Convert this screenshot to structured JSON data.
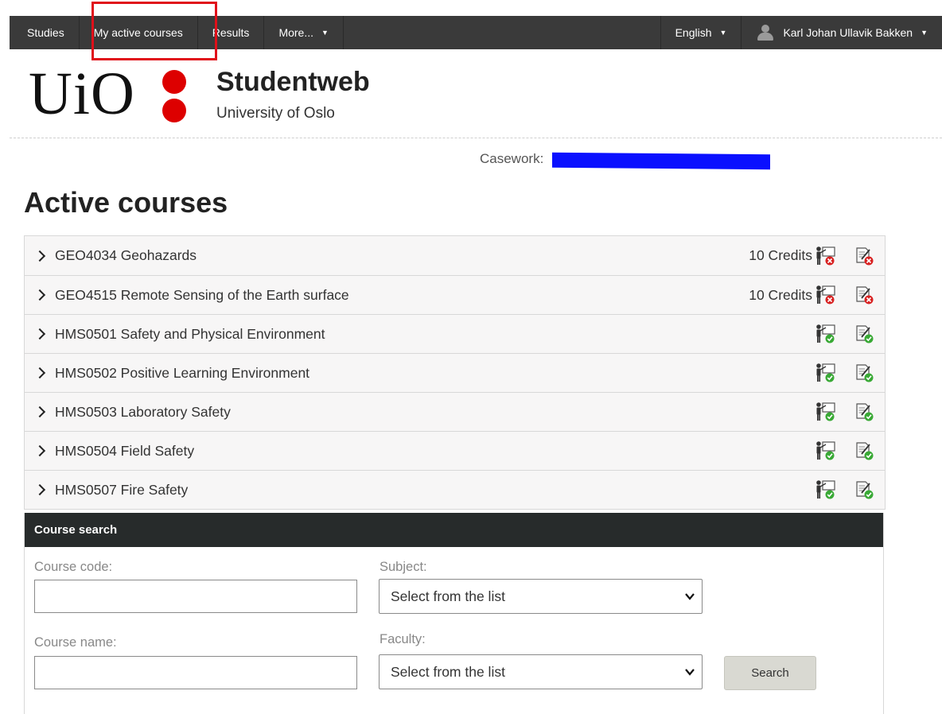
{
  "nav": {
    "studies": "Studies",
    "my_active_courses": "My active courses",
    "results": "Results",
    "more": "More...",
    "language": "English",
    "user": "Karl Johan Ullavik Bakken"
  },
  "header": {
    "logo": "UiO",
    "title": "Studentweb",
    "subtitle": "University of Oslo"
  },
  "casework_label": "Casework:",
  "page_title": "Active courses",
  "courses": [
    {
      "name": "GEO4034 Geohazards",
      "credits": "10 Credits",
      "status": "not-registered"
    },
    {
      "name": "GEO4515 Remote Sensing of the Earth surface",
      "credits": "10 Credits",
      "status": "not-registered"
    },
    {
      "name": "HMS0501 Safety and Physical Environment",
      "credits": "",
      "status": "registered"
    },
    {
      "name": "HMS0502 Positive Learning Environment",
      "credits": "",
      "status": "registered"
    },
    {
      "name": "HMS0503 Laboratory Safety",
      "credits": "",
      "status": "registered"
    },
    {
      "name": "HMS0504 Field Safety",
      "credits": "",
      "status": "registered"
    },
    {
      "name": "HMS0507 Fire Safety",
      "credits": "",
      "status": "registered"
    }
  ],
  "search": {
    "heading": "Course search",
    "course_code_label": "Course code:",
    "course_code_value": "",
    "subject_label": "Subject:",
    "subject_selected": "Select from the list",
    "course_name_label": "Course name:",
    "course_name_value": "",
    "faculty_label": "Faculty:",
    "faculty_selected": "Select from the list",
    "button": "Search"
  },
  "colors": {
    "nav_bg": "#3a3a3a",
    "highlight": "#e0101a",
    "logo_red": "#dd0000",
    "status_red": "#d82020",
    "status_green": "#39a935",
    "redaction": "#0a10ff"
  }
}
